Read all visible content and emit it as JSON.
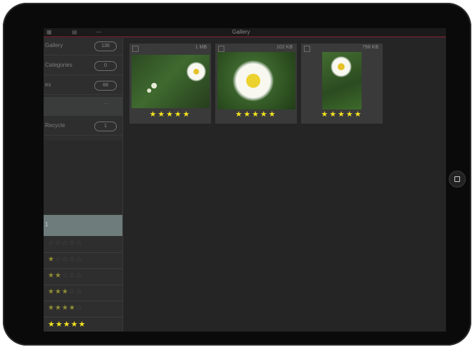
{
  "statusbar": {
    "title": "Gallery",
    "icons": [
      "grid-icon",
      "folder-icon",
      "minus-icon"
    ]
  },
  "sidebar": {
    "rows": [
      {
        "label": "Gallery",
        "count": "136"
      },
      {
        "label": "Categories",
        "count": "0"
      },
      {
        "label": "es",
        "count": "68"
      },
      {
        "label": "",
        "count": "---"
      },
      {
        "label": "Recycle",
        "count": "1"
      }
    ],
    "rating_header": "1",
    "rating_rows": [
      {
        "filled": "",
        "empty": "☆☆☆☆☆"
      },
      {
        "filled": "★",
        "empty": "☆☆☆☆"
      },
      {
        "filled": "★★",
        "empty": "☆☆☆"
      },
      {
        "filled": "★★★",
        "empty": "☆☆"
      },
      {
        "filled": "★★★★",
        "empty": "☆"
      },
      {
        "filled": "★★★★★",
        "empty": ""
      }
    ]
  },
  "photos": [
    {
      "size": "1 MB",
      "rating": "★★★★★",
      "rating_value": 5
    },
    {
      "size": "102 KB",
      "rating": "★★★★★",
      "rating_value": 5
    },
    {
      "size": "798 KB",
      "rating": "★★★★★",
      "rating_value": 5
    }
  ],
  "device": {
    "home_button": "home-button"
  }
}
